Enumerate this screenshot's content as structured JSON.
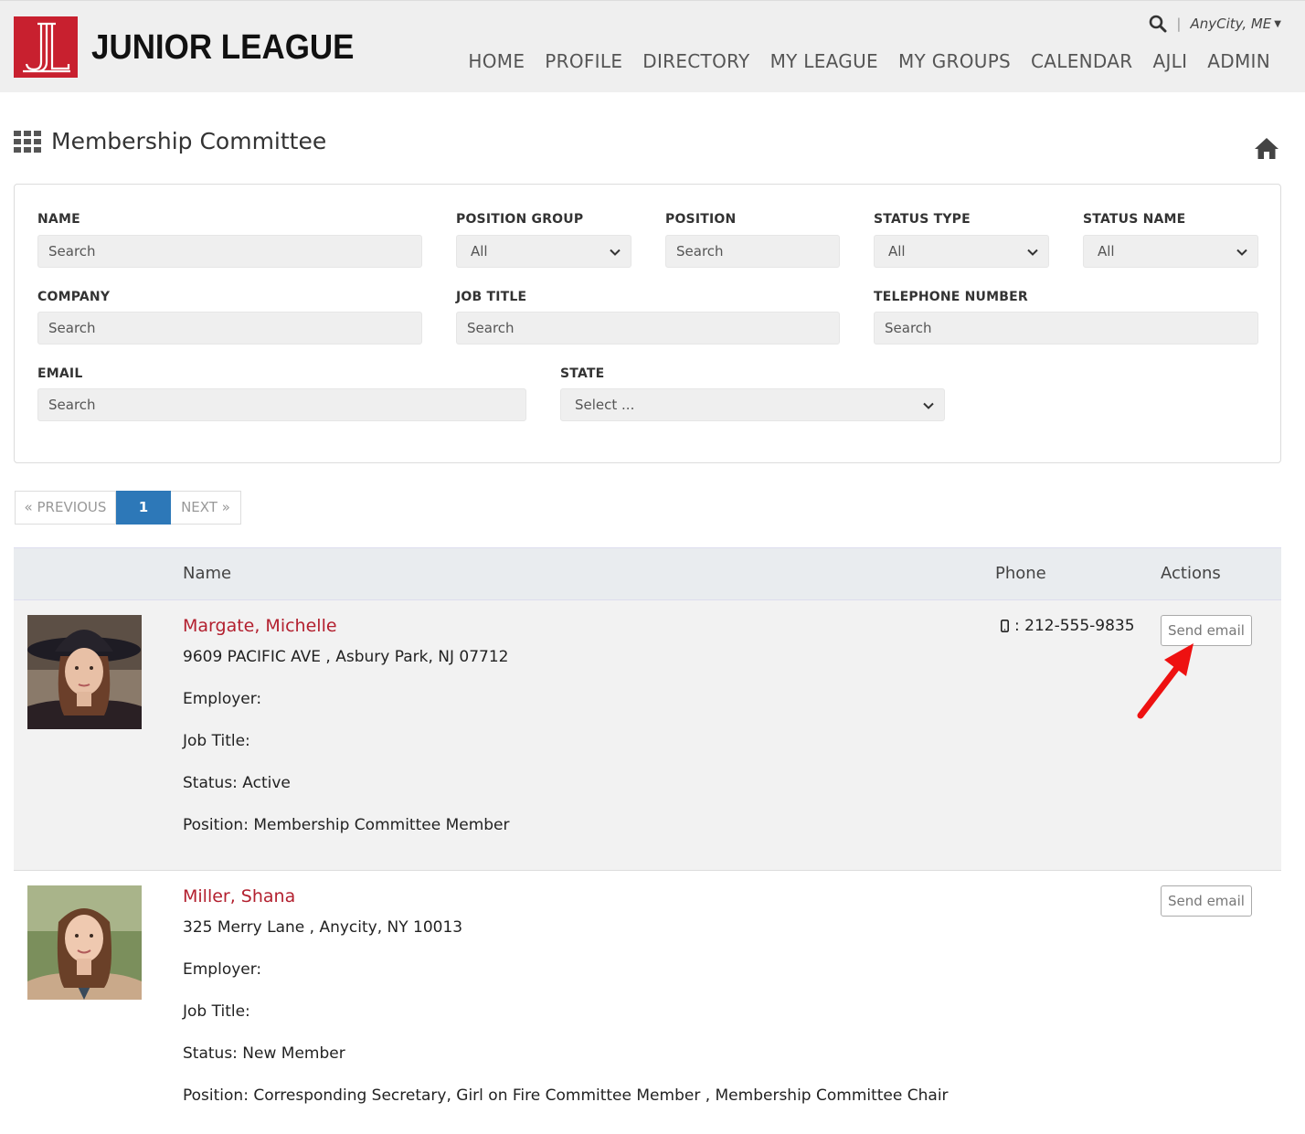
{
  "header": {
    "brand": "JUNIOR LEAGUE",
    "city": "AnyCity, ME",
    "nav": [
      "HOME",
      "PROFILE",
      "DIRECTORY",
      "MY LEAGUE",
      "MY GROUPS",
      "CALENDAR",
      "AJLI",
      "ADMIN"
    ]
  },
  "page": {
    "title": "Membership Committee"
  },
  "filters": {
    "name": {
      "label": "NAME",
      "placeholder": "Search"
    },
    "position_group": {
      "label": "POSITION GROUP",
      "value": "All"
    },
    "position": {
      "label": "POSITION",
      "placeholder": "Search"
    },
    "status_type": {
      "label": "STATUS TYPE",
      "value": "All"
    },
    "status_name": {
      "label": "STATUS NAME",
      "value": "All"
    },
    "company": {
      "label": "COMPANY",
      "placeholder": "Search"
    },
    "job_title": {
      "label": "JOB TITLE",
      "placeholder": "Search"
    },
    "telephone": {
      "label": "TELEPHONE NUMBER",
      "placeholder": "Search"
    },
    "email": {
      "label": "EMAIL",
      "placeholder": "Search"
    },
    "state": {
      "label": "STATE",
      "value": "Select ..."
    }
  },
  "pager": {
    "prev": "« PREVIOUS",
    "current": "1",
    "next": "NEXT »"
  },
  "table": {
    "headers": {
      "name": "Name",
      "phone": "Phone",
      "actions": "Actions"
    },
    "rows": [
      {
        "name": "Margate, Michelle",
        "address": "9609 PACIFIC AVE , Asbury Park, NJ 07712",
        "employer": "Employer:",
        "job_title": "Job Title:",
        "status": "Status: Active",
        "position": "Position: Membership Committee Member",
        "phone": ": 212-555-9835",
        "action": "Send email"
      },
      {
        "name": "Miller, Shana",
        "address": "325 Merry Lane , Anycity, NY 10013",
        "employer": "Employer:",
        "job_title": "Job Title:",
        "status": "Status: New Member",
        "position": "Position: Corresponding Secretary, Girl on Fire Committee Member , Membership Committee Chair",
        "phone": "",
        "action": "Send email"
      }
    ]
  },
  "colors": {
    "brand": "#c8202f",
    "link": "#b3202f",
    "active_page": "#2d78b8",
    "annotation_arrow": "#ee1111"
  }
}
